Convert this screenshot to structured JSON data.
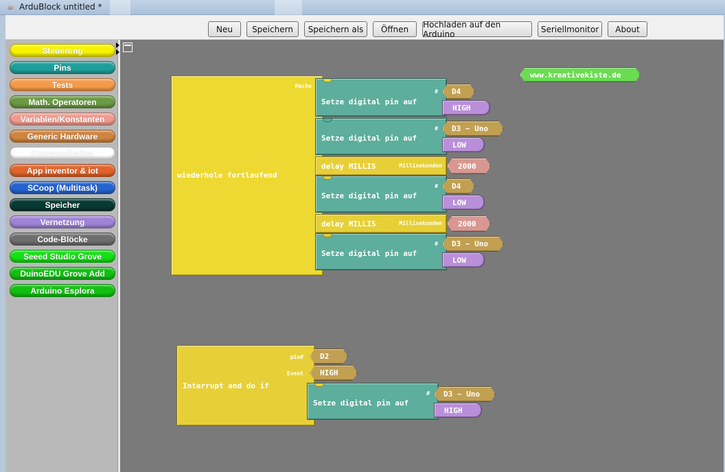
{
  "window": {
    "title": "ArduBlock untitled *"
  },
  "toolbar": {
    "buttons": [
      {
        "label": "Neu"
      },
      {
        "label": "Speichern"
      },
      {
        "label": "Speichern als"
      },
      {
        "label": "Öffnen"
      },
      {
        "label": "Hochladen auf den Arduino"
      },
      {
        "label": "Seriellmonitor"
      },
      {
        "label": "About"
      }
    ]
  },
  "categories": [
    {
      "label": "Steuerung",
      "color": "#f7f300"
    },
    {
      "label": "Pins",
      "color": "#1f9f9a"
    },
    {
      "label": "Tests",
      "color": "#f59a4a"
    },
    {
      "label": "Math. Operatoren",
      "color": "#6a9a43"
    },
    {
      "label": "Variablen/Konstanten",
      "color": "#f19b8e"
    },
    {
      "label": "Generic Hardware",
      "color": "#d0843d"
    },
    {
      "label": "Kommunikation",
      "color": "#ffffff"
    },
    {
      "label": "App inventor & iot",
      "color": "#e0642b"
    },
    {
      "label": "SCoop (Multitask)",
      "color": "#2463d0"
    },
    {
      "label": "Speicher",
      "color": "#063a32"
    },
    {
      "label": "Vernetzung",
      "color": "#9f84d6"
    },
    {
      "label": "Code-Blöcke",
      "color": "#6e6e6e"
    },
    {
      "label": "Seeed Studio Grove",
      "color": "#14e014"
    },
    {
      "label": "DuinoEDU Grove Add",
      "color": "#12c012"
    },
    {
      "label": "Arduino Esplora",
      "color": "#12c012"
    }
  ],
  "blocks": {
    "loop": {
      "label": "wiederhole fortlaufend",
      "sub": "Mache",
      "statements": [
        {
          "label": "Setze digital pin auf",
          "hash": "#",
          "pin": "D4",
          "value": "HIGH"
        },
        {
          "label": "Setze digital pin auf",
          "hash": "#",
          "pin": "D3 ~ Uno",
          "value": "LOW"
        },
        {
          "label": "delay MILLIS",
          "unit": "Millisekunden",
          "ms": "2000"
        },
        {
          "label": "Setze digital pin auf",
          "hash": "#",
          "pin": "D4",
          "value": "LOW"
        },
        {
          "label": "delay MILLIS",
          "unit": "Millisekunden",
          "ms": "2000"
        },
        {
          "label": "Setze digital pin auf",
          "hash": "#",
          "pin": "D3 ~ Uno",
          "value": "LOW"
        }
      ]
    },
    "interrupt": {
      "label": "Interrupt and do if",
      "pin_label": "pin#",
      "pin": "D2",
      "event_label": "Event",
      "event": "HIGH",
      "statement": {
        "label": "Setze digital pin auf",
        "hash": "#",
        "pin": "D3 ~ Uno",
        "value": "HIGH"
      }
    },
    "website": {
      "label": "www.kreativekiste.de"
    }
  },
  "colors": {
    "canvas": "#7a7a7a",
    "control_block": "#eed932",
    "pin_block": "#5dae9c",
    "pin_value": "#c1a052",
    "state_value": "#b98fd9",
    "number_value": "#d89891",
    "comment_block": "#6bdc52"
  }
}
